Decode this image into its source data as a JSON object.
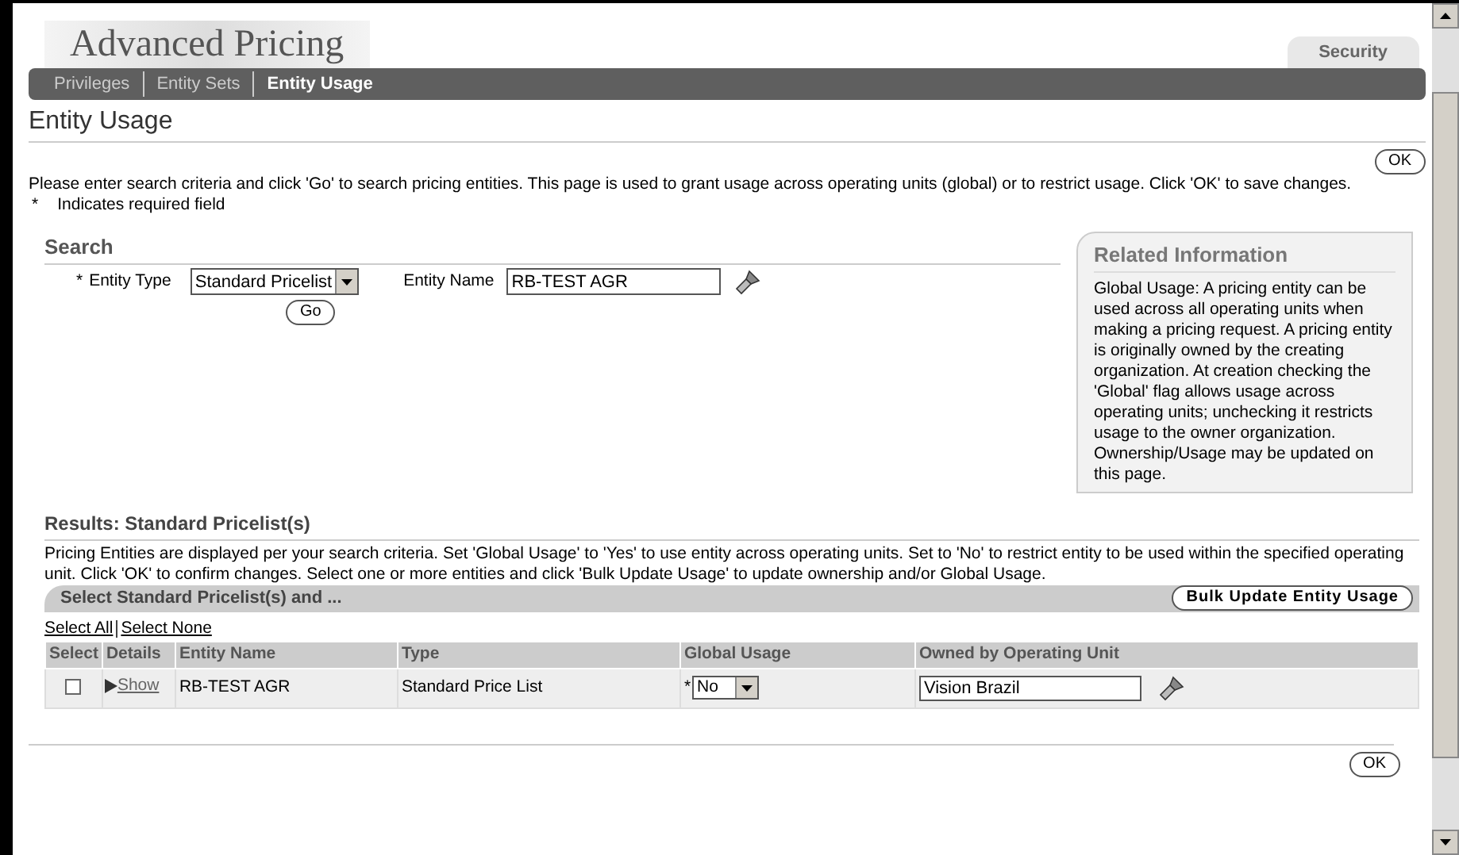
{
  "app_title": "Advanced Pricing",
  "top_tabs": [
    {
      "label": "Security",
      "selected": true
    }
  ],
  "sub_tabs": [
    {
      "label": "Privileges",
      "selected": false
    },
    {
      "label": "Entity Sets",
      "selected": false
    },
    {
      "label": "Entity Usage",
      "selected": true
    }
  ],
  "page_title": "Entity Usage",
  "ok_button": "OK",
  "instructions": "Please enter search criteria and click 'Go' to search pricing entities. This page is used to grant usage across operating units (global) or to restrict usage. Click 'OK' to save changes.",
  "required_note": {
    "mark": "*",
    "text": "Indicates required field"
  },
  "search": {
    "heading": "Search",
    "entity_type": {
      "label": "Entity Type",
      "value": "Standard Pricelist"
    },
    "entity_name": {
      "label": "Entity Name",
      "value": "RB-TEST AGR"
    },
    "go_button": "Go"
  },
  "related": {
    "title": "Related Information",
    "text": "Global Usage: A pricing entity can be used across all operating units when making a pricing request. A pricing entity is originally owned by the creating organization. At creation checking the 'Global' flag allows usage across operating units; unchecking it restricts usage to the owner organization. Ownership/Usage may be updated on this page."
  },
  "results": {
    "heading": "Results: Standard Pricelist(s)",
    "description": "Pricing Entities are displayed per your search criteria. Set 'Global Usage' to 'Yes' to use entity across operating units. Set to 'No' to restrict entity to be used within the specified operating unit. Click 'OK' to confirm changes. Select one or more entities and click 'Bulk Update Usage' to update ownership and/or Global Usage.",
    "bar_title": "Select Standard Pricelist(s) and ...",
    "bulk_button": "Bulk Update Entity Usage",
    "select_all": "Select All",
    "select_none": "Select None",
    "columns": [
      "Select",
      "Details",
      "Entity Name",
      "Type",
      "Global Usage",
      "Owned by Operating Unit"
    ],
    "rows": [
      {
        "checked": false,
        "details": "Show",
        "entity_name": "RB-TEST AGR",
        "type": "Standard Price List",
        "global_usage": "No",
        "owner": "Vision Brazil"
      }
    ]
  },
  "bottom_ok": "OK"
}
